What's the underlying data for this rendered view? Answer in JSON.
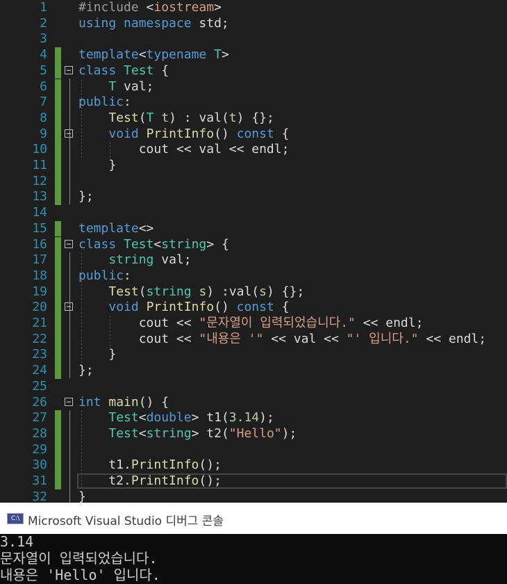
{
  "editor": {
    "line_numbers": [
      "1",
      "2",
      "3",
      "4",
      "5",
      "6",
      "7",
      "8",
      "9",
      "10",
      "11",
      "12",
      "13",
      "14",
      "15",
      "16",
      "17",
      "18",
      "19",
      "20",
      "21",
      "22",
      "23",
      "24",
      "25",
      "26",
      "27",
      "28",
      "29",
      "30",
      "31",
      "32"
    ],
    "lines": [
      [
        [
          "pp",
          "#include "
        ],
        [
          "op",
          "<"
        ],
        [
          "str",
          "iostream"
        ],
        [
          "op",
          ">"
        ]
      ],
      [
        [
          "kw",
          "using"
        ],
        [
          "op",
          " "
        ],
        [
          "kw",
          "namespace"
        ],
        [
          "op",
          " std;"
        ]
      ],
      [],
      [
        [
          "kw",
          "template"
        ],
        [
          "op",
          "<"
        ],
        [
          "kw",
          "typename"
        ],
        [
          "op",
          " "
        ],
        [
          "ty",
          "T"
        ],
        [
          "op",
          ">"
        ]
      ],
      [
        [
          "kw",
          "class"
        ],
        [
          "op",
          " "
        ],
        [
          "ty",
          "Test"
        ],
        [
          "op",
          " {"
        ]
      ],
      [
        [
          "op",
          "    "
        ],
        [
          "ty",
          "T"
        ],
        [
          "op",
          " val;"
        ]
      ],
      [
        [
          "kw",
          "public"
        ],
        [
          "op",
          ":"
        ]
      ],
      [
        [
          "op",
          "    "
        ],
        [
          "fn",
          "Test"
        ],
        [
          "op",
          "("
        ],
        [
          "ty",
          "T"
        ],
        [
          "op",
          " "
        ],
        [
          "tp",
          "t"
        ],
        [
          "op",
          ") : val("
        ],
        [
          "tp",
          "t"
        ],
        [
          "op",
          ") {};"
        ]
      ],
      [
        [
          "op",
          "    "
        ],
        [
          "kw",
          "void"
        ],
        [
          "op",
          " "
        ],
        [
          "fn",
          "PrintInfo"
        ],
        [
          "op",
          "() "
        ],
        [
          "kw",
          "const"
        ],
        [
          "op",
          " {"
        ]
      ],
      [
        [
          "op",
          "        cout << val << endl;"
        ]
      ],
      [
        [
          "op",
          "    }"
        ]
      ],
      [],
      [
        [
          "op",
          "};"
        ]
      ],
      [],
      [
        [
          "kw",
          "template"
        ],
        [
          "op",
          "<>"
        ]
      ],
      [
        [
          "kw",
          "class"
        ],
        [
          "op",
          " "
        ],
        [
          "ty",
          "Test"
        ],
        [
          "op",
          "<"
        ],
        [
          "ty",
          "string"
        ],
        [
          "op",
          "> {"
        ]
      ],
      [
        [
          "op",
          "    "
        ],
        [
          "ty",
          "string"
        ],
        [
          "op",
          " val;"
        ]
      ],
      [
        [
          "kw",
          "public"
        ],
        [
          "op",
          ":"
        ]
      ],
      [
        [
          "op",
          "    "
        ],
        [
          "fn",
          "Test"
        ],
        [
          "op",
          "("
        ],
        [
          "ty",
          "string"
        ],
        [
          "op",
          " "
        ],
        [
          "tp",
          "s"
        ],
        [
          "op",
          ") :val("
        ],
        [
          "tp",
          "s"
        ],
        [
          "op",
          ") {};"
        ]
      ],
      [
        [
          "op",
          "    "
        ],
        [
          "kw",
          "void"
        ],
        [
          "op",
          " "
        ],
        [
          "fn",
          "PrintInfo"
        ],
        [
          "op",
          "() "
        ],
        [
          "kw",
          "const"
        ],
        [
          "op",
          " {"
        ]
      ],
      [
        [
          "op",
          "        cout << "
        ],
        [
          "str",
          "\"문자열이 입력되었습니다.\""
        ],
        [
          "op",
          " << endl;"
        ]
      ],
      [
        [
          "op",
          "        cout << "
        ],
        [
          "str",
          "\"내용은 '\""
        ],
        [
          "op",
          " << val << "
        ],
        [
          "str",
          "\"' 입니다.\""
        ],
        [
          "op",
          " << endl;"
        ]
      ],
      [
        [
          "op",
          "    }"
        ]
      ],
      [
        [
          "op",
          "};"
        ]
      ],
      [],
      [
        [
          "kw",
          "int"
        ],
        [
          "op",
          " "
        ],
        [
          "fn",
          "main"
        ],
        [
          "op",
          "() {"
        ]
      ],
      [
        [
          "op",
          "    "
        ],
        [
          "ty",
          "Test"
        ],
        [
          "op",
          "<"
        ],
        [
          "kw",
          "double"
        ],
        [
          "op",
          "> t1("
        ],
        [
          "num",
          "3.14"
        ],
        [
          "op",
          ");"
        ]
      ],
      [
        [
          "op",
          "    "
        ],
        [
          "ty",
          "Test"
        ],
        [
          "op",
          "<"
        ],
        [
          "ty",
          "string"
        ],
        [
          "op",
          "> t2("
        ],
        [
          "str",
          "\"Hello\""
        ],
        [
          "op",
          ");"
        ]
      ],
      [],
      [
        [
          "op",
          "    t1."
        ],
        [
          "fn",
          "PrintInfo"
        ],
        [
          "op",
          "();"
        ]
      ],
      [
        [
          "op",
          "    t2."
        ],
        [
          "fn",
          "PrintInfo"
        ],
        [
          "op",
          "();"
        ]
      ],
      [
        [
          "op",
          "}"
        ]
      ]
    ],
    "fold_symbol": "−",
    "fold_lines": [
      5,
      9,
      16,
      20,
      26
    ],
    "changed_lines": [
      4,
      5,
      6,
      7,
      8,
      9,
      10,
      11,
      12,
      13,
      15,
      16,
      17,
      18,
      19,
      20,
      21,
      22,
      23,
      24,
      27,
      28,
      29,
      30,
      31
    ],
    "current_line": 31
  },
  "console": {
    "icon_label": "C:\\",
    "title": "Microsoft Visual Studio 디버그 콘솔",
    "output": [
      "3.14",
      "문자열이 입력되었습니다.",
      "내용은 'Hello' 입니다."
    ]
  },
  "colors": {
    "editor_bg": "#1e1e1e",
    "keyword": "#569cd6",
    "type": "#4ec9b0",
    "function": "#dcdcaa",
    "string": "#d69d85",
    "number": "#b5cea8",
    "preprocessor": "#9b9b9b",
    "line_number": "#2b91af",
    "change_bar": "#5b9a3c",
    "console_bg": "#0c0c0c"
  }
}
